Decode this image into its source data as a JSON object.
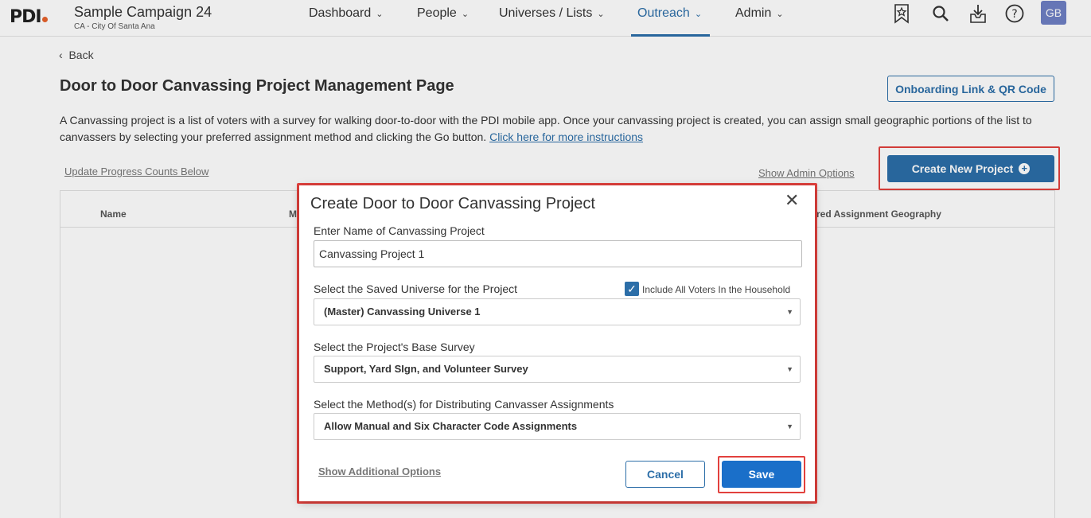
{
  "header": {
    "logo_text": "PDI",
    "campaign_name": "Sample Campaign 24",
    "campaign_location": "CA - City Of Santa Ana",
    "nav": [
      {
        "label": "Dashboard"
      },
      {
        "label": "People"
      },
      {
        "label": "Universes / Lists"
      },
      {
        "label": "Outreach",
        "active": true
      },
      {
        "label": "Admin"
      }
    ],
    "icons": [
      "bookmark-star-icon",
      "search-icon",
      "download-tray-icon",
      "help-icon"
    ],
    "avatar_initials": "GB"
  },
  "page": {
    "back_label": "Back",
    "title": "Door to Door Canvassing Project Management Page",
    "onboarding_button": "Onboarding Link & QR Code",
    "description": "A Canvassing project is a list of voters with a survey for walking door-to-door with the PDI mobile app. Once your canvassing project is created, you can assign small geographic portions of the list to canvassers by selecting your preferred assignment method and clicking the Go button.",
    "instructions_link": "Click here for more instructions",
    "update_progress_link": "Update Progress Counts Below",
    "show_admin_link": "Show Admin Options",
    "create_button": "Create New Project",
    "table_headers": {
      "name": "Name",
      "m": "M",
      "assignment_geography": "red Assignment Geography"
    }
  },
  "modal": {
    "title": "Create Door to Door Canvassing Project",
    "name_label": "Enter Name of Canvassing Project",
    "name_value": "Canvassing Project 1",
    "universe_label": "Select the Saved Universe for the Project",
    "include_household_label": "Include All Voters In the Household",
    "include_household_checked": true,
    "universe_value": "(Master) Canvassing Universe 1",
    "survey_label": "Select the Project's Base Survey",
    "survey_value": "Support, Yard SIgn, and Volunteer Survey",
    "method_label": "Select the Method(s) for Distributing Canvasser Assignments",
    "method_value": "Allow Manual and Six Character Code Assignments",
    "additional_options_link": "Show Additional Options",
    "cancel_label": "Cancel",
    "save_label": "Save"
  },
  "colors": {
    "accent": "#2c6ea8",
    "save": "#1a6fc9",
    "highlight": "#e2413d",
    "logo_dot": "#e8622c",
    "avatar": "#6e7fc4"
  }
}
